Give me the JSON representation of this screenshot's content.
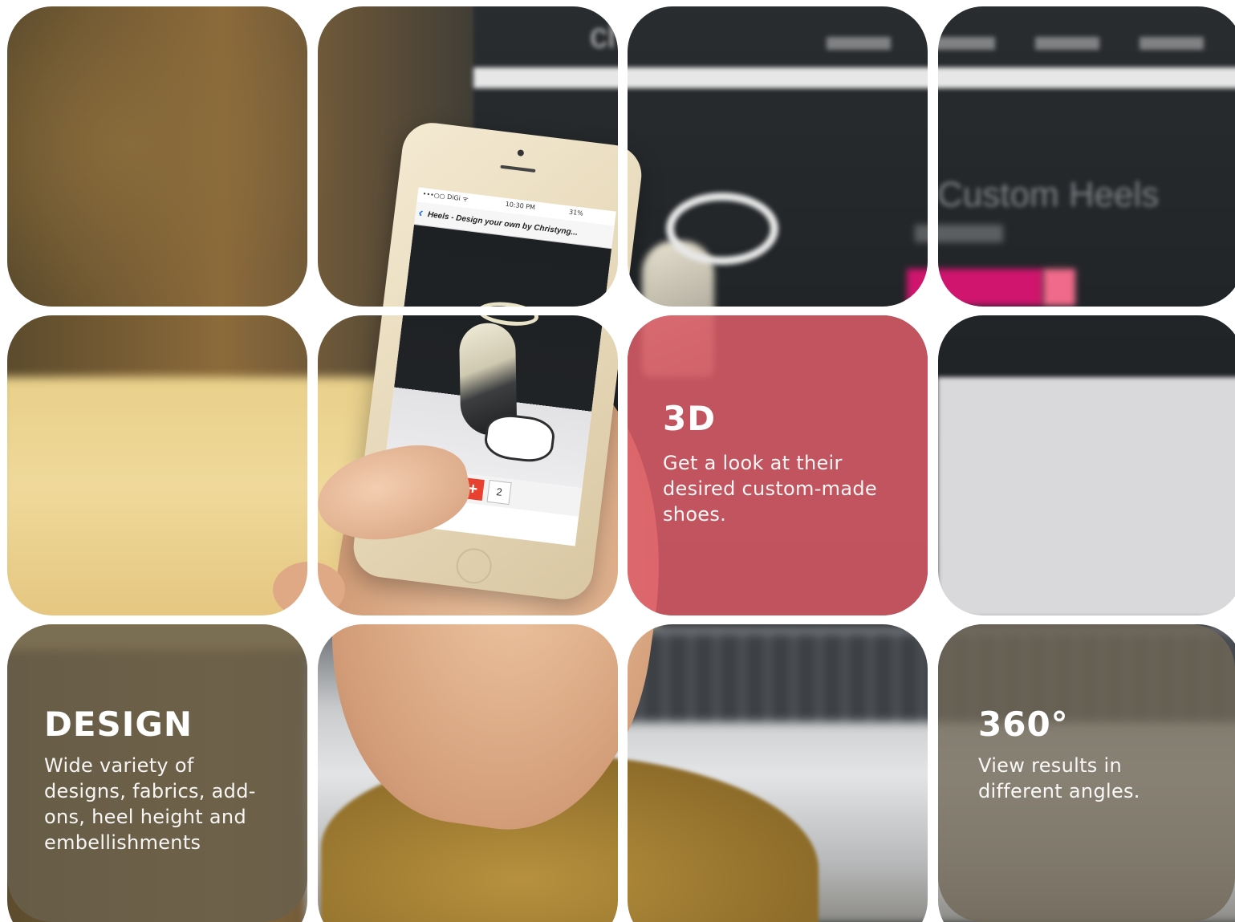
{
  "features": {
    "three_d": {
      "title": "3D",
      "description": "Get a look at their desired custom-made shoes."
    },
    "design": {
      "title": "DESIGN",
      "description": "Wide variety of designs, fabrics, add-ons, heel height and embellishments"
    },
    "view360": {
      "title": "360°",
      "description": "View results in different angles."
    }
  },
  "phone": {
    "carrier": "•••○○ DiGi ᯤ",
    "time": "10:30 PM",
    "battery": "31%",
    "nav_title": "Heels - Design your own by Christyng...",
    "quantity": "2"
  },
  "laptop_screen": {
    "heading": "Custom Heels"
  },
  "colors": {
    "tile_3d": "#dc5c68",
    "tile_neutral": "#69604c",
    "cta_magenta": "#d0156e",
    "plus_red": "#e8412f"
  }
}
